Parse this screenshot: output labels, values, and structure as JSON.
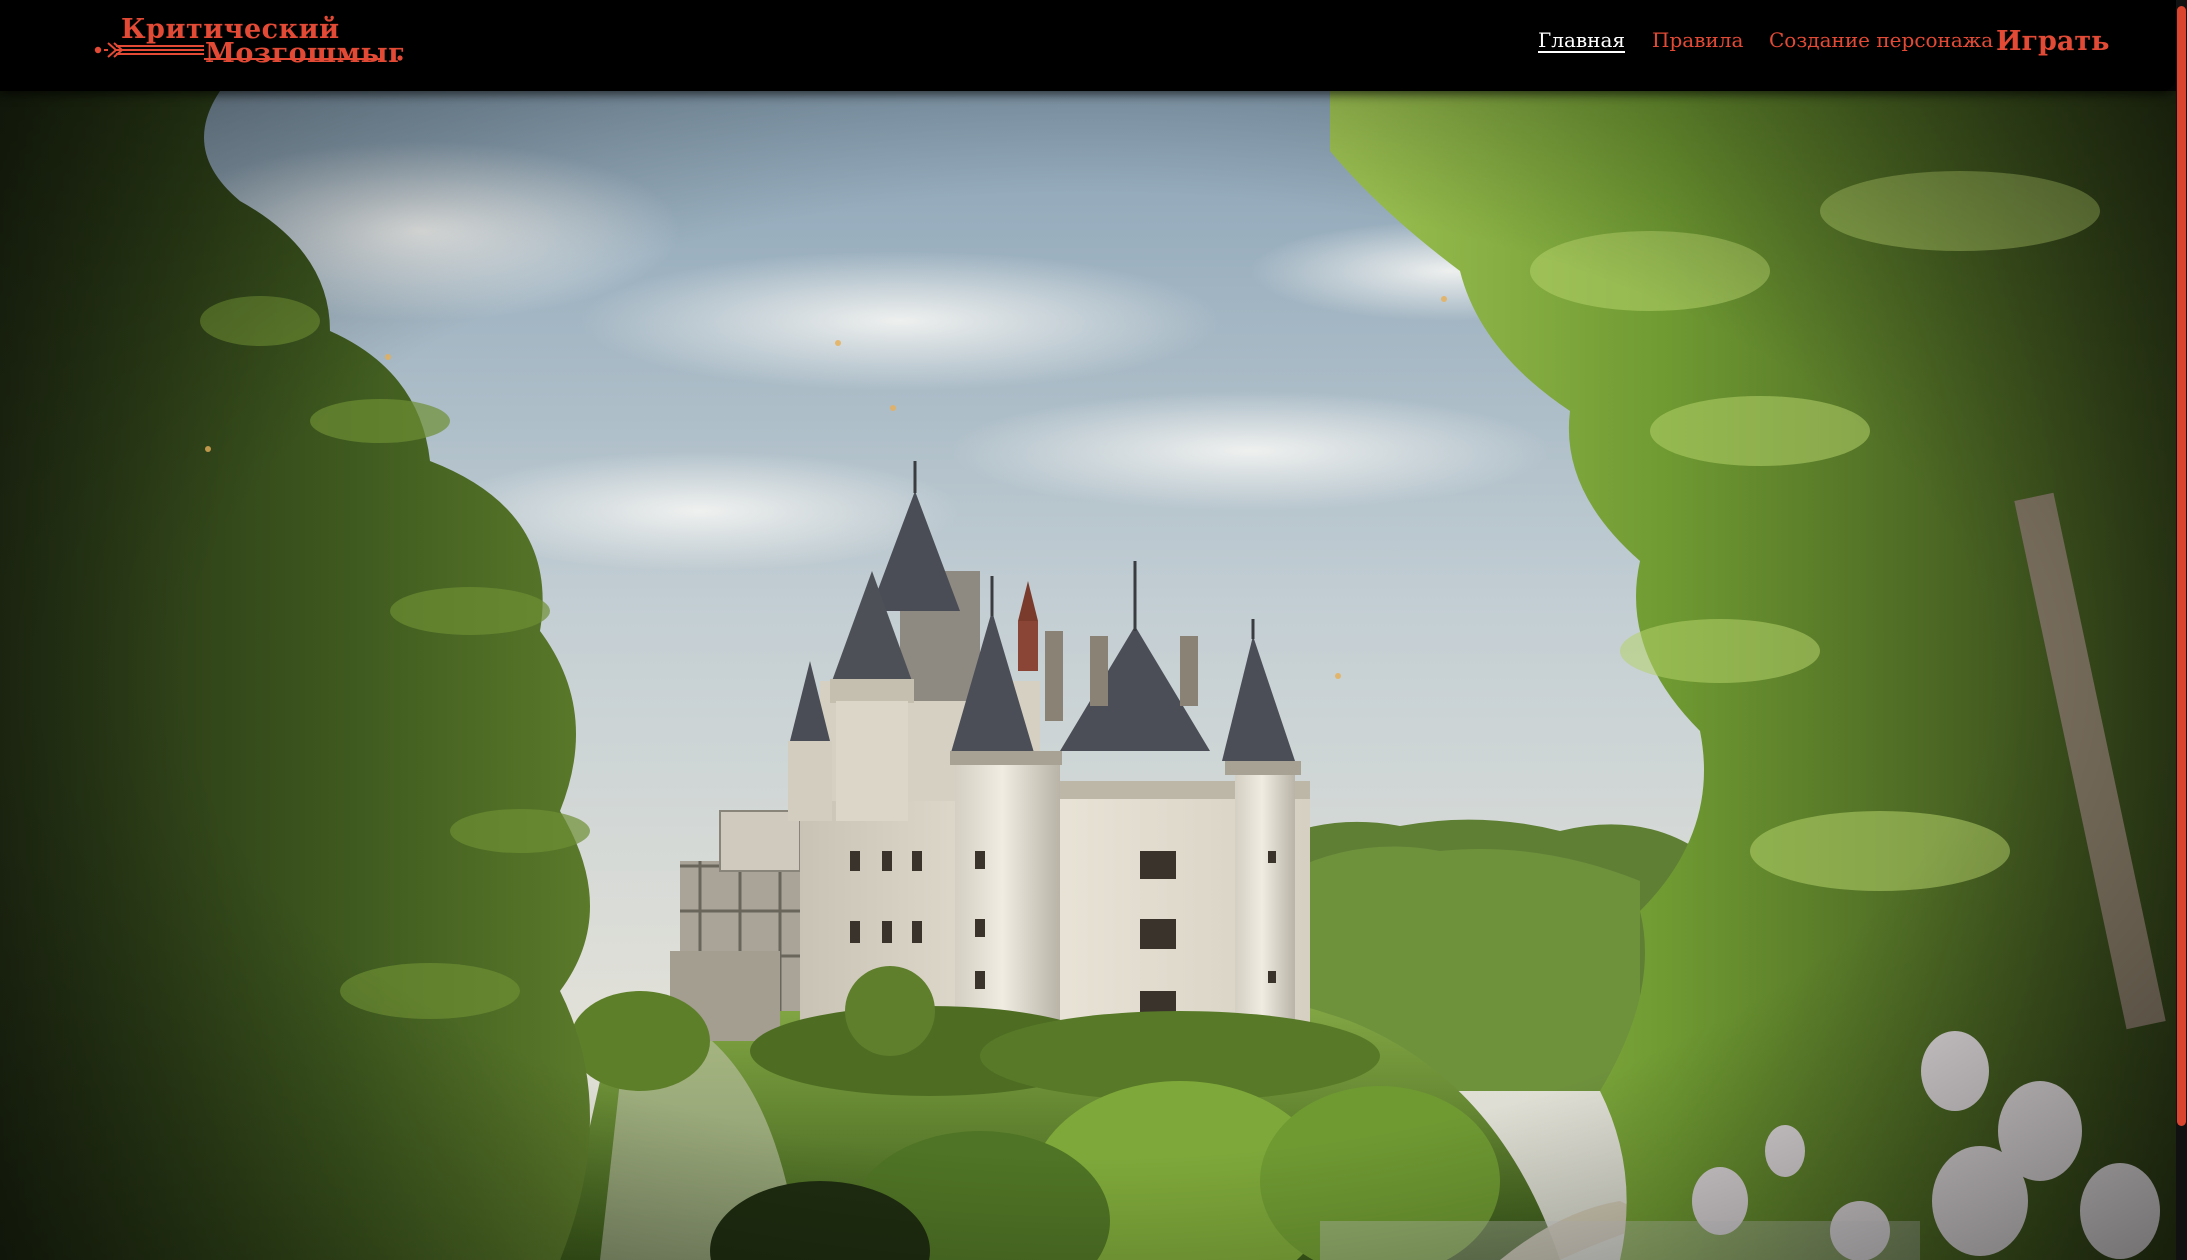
{
  "brand": {
    "line1": "Критический",
    "line2": "Мозгошмыг",
    "color": "#e34a35"
  },
  "nav": {
    "items": [
      {
        "label": "Главная",
        "active": true
      },
      {
        "label": "Правила",
        "active": false
      },
      {
        "label": "Создание персонажа",
        "active": false
      },
      {
        "label": "Играть",
        "active": false
      }
    ],
    "active_color": "#ffffff",
    "link_color": "#e34a35"
  },
  "hero": {
    "image": "castle-on-hill-forest-scene"
  },
  "scrollbar": {
    "thumb_color": "#d9452f",
    "position_fraction": 0.0
  }
}
